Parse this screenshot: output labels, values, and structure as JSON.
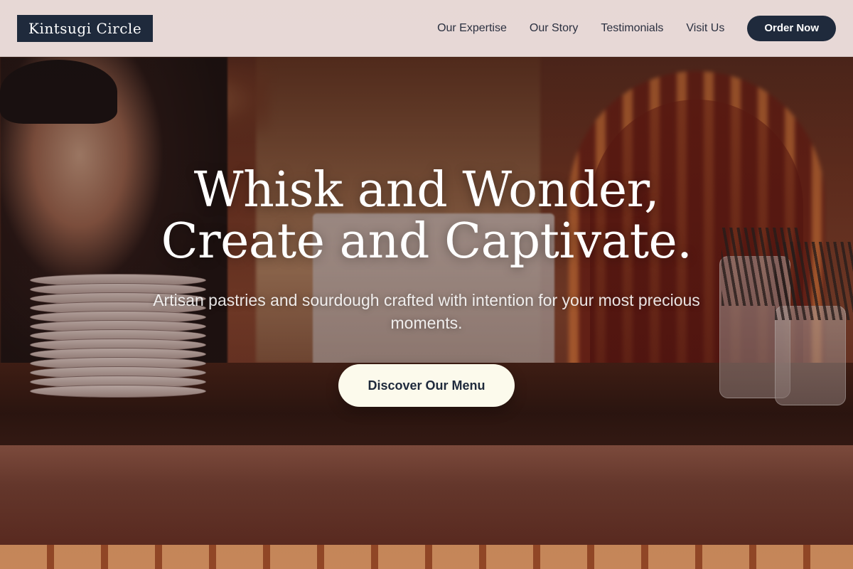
{
  "brand": {
    "name": "Kintsugi Circle"
  },
  "nav": {
    "links": [
      "Our Expertise",
      "Our Story",
      "Testimonials",
      "Visit Us"
    ],
    "cta_label": "Order Now"
  },
  "hero": {
    "title_line1": "Whisk and Wonder,",
    "title_line2": "Create and Captivate.",
    "subtitle": "Artisan pastries and sourdough crafted with intention for your most precious moments.",
    "cta_label": "Discover Our Menu"
  },
  "colors": {
    "brand_navy": "#1f2a3c",
    "header_bg": "#f5e8e6",
    "cta_cream": "#fcfaec"
  }
}
